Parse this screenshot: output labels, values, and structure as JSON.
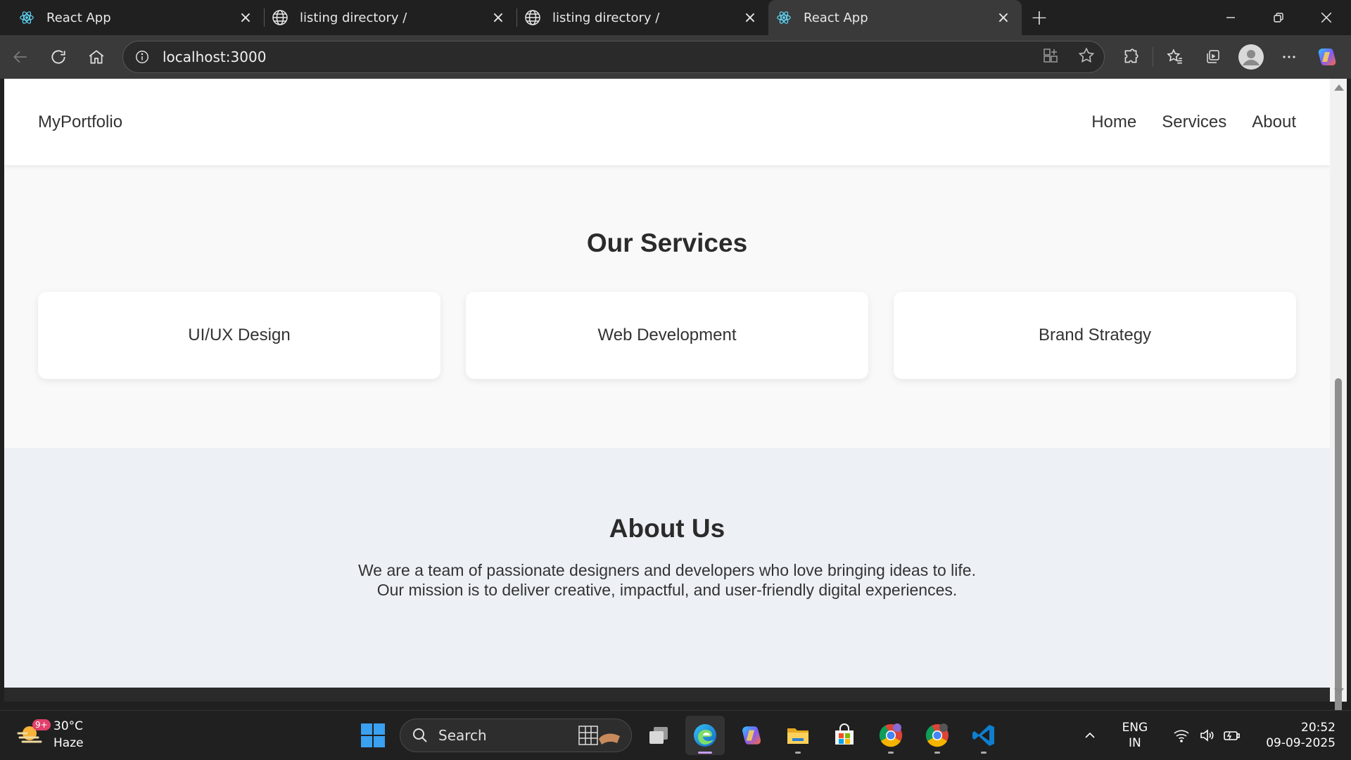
{
  "browser": {
    "tabs": [
      {
        "title": "React App",
        "icon": "react-icon",
        "active": false
      },
      {
        "title": "listing directory /",
        "icon": "globe-icon",
        "active": false
      },
      {
        "title": "listing directory /",
        "icon": "globe-icon",
        "active": false
      },
      {
        "title": "React App",
        "icon": "react-icon",
        "active": true
      }
    ],
    "address": "localhost:3000"
  },
  "page": {
    "logo": "MyPortfolio",
    "nav": [
      "Home",
      "Services",
      "About"
    ],
    "services": {
      "title": "Our Services",
      "cards": [
        "UI/UX Design",
        "Web Development",
        "Brand Strategy"
      ]
    },
    "about": {
      "title": "About Us",
      "text": "We are a team of passionate designers and developers who love bringing ideas to life. Our mission is to deliver creative, impactful, and user-friendly digital experiences."
    }
  },
  "taskbar": {
    "weather": {
      "temp": "30°C",
      "condition": "Haze",
      "badge": "9+"
    },
    "search_label": "Search",
    "lang": {
      "line1": "ENG",
      "line2": "IN"
    },
    "clock": {
      "time": "20:52",
      "date": "09-09-2025"
    }
  },
  "colors": {
    "accent": "#c89df0",
    "page_bg": "#f9f9f9",
    "about_bg": "#edf1f6"
  }
}
